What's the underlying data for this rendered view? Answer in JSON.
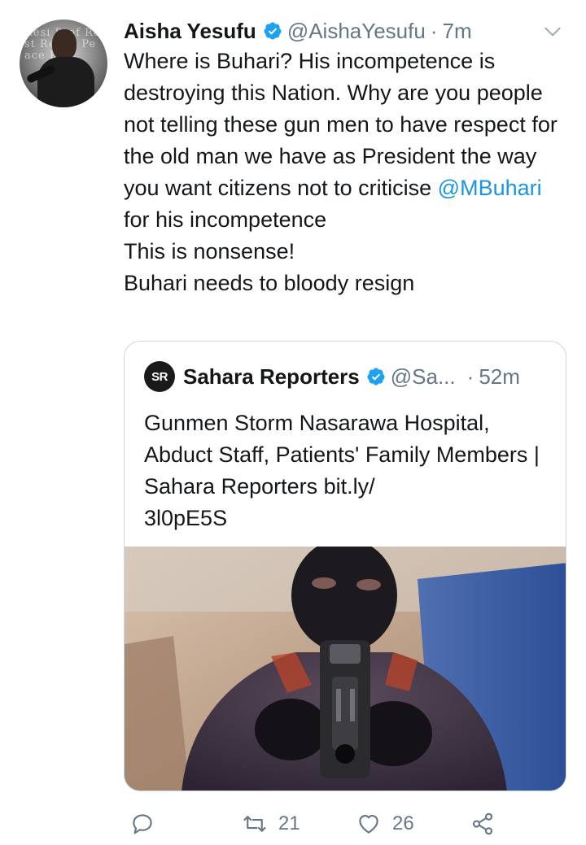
{
  "author": {
    "display_name": "Aisha Yesufu",
    "handle": "@AishaYesufu",
    "separator": "·",
    "time": "7m",
    "verified": true,
    "avatar_caption": "Resi Prof Rest Resist Peace Prof"
  },
  "tweet": {
    "text_before_mention": "Where is Buhari? His incompetence is destroying this Nation. Why are you people not telling these gun men to have respect for the old man we have as President the way you want citizens not to criticise ",
    "mention": "@MBuhari",
    "text_after_mention": " for his incompetence\nThis is nonsense!\nBuhari needs to bloody resign"
  },
  "quoted_tweet": {
    "logo_text": "SR",
    "display_name": "Sahara Reporters",
    "handle": "@Sa...",
    "separator": "·",
    "time": "52m",
    "verified": true,
    "text": "Gunmen Storm Nasarawa Hospital, Abduct Staff, Patients' Family Members | Sahara Reporters bit.ly/\n3l0pE5S"
  },
  "actions": {
    "reply_icon": "reply-icon",
    "retweet_icon": "retweet-icon",
    "retweet_count": "21",
    "like_icon": "heart-icon",
    "like_count": "26",
    "share_icon": "share-icon"
  },
  "colors": {
    "text": "#14171a",
    "secondary": "#657786",
    "link": "#1b95e0",
    "verified": "#1da1f2",
    "border": "#ccd6dd"
  }
}
